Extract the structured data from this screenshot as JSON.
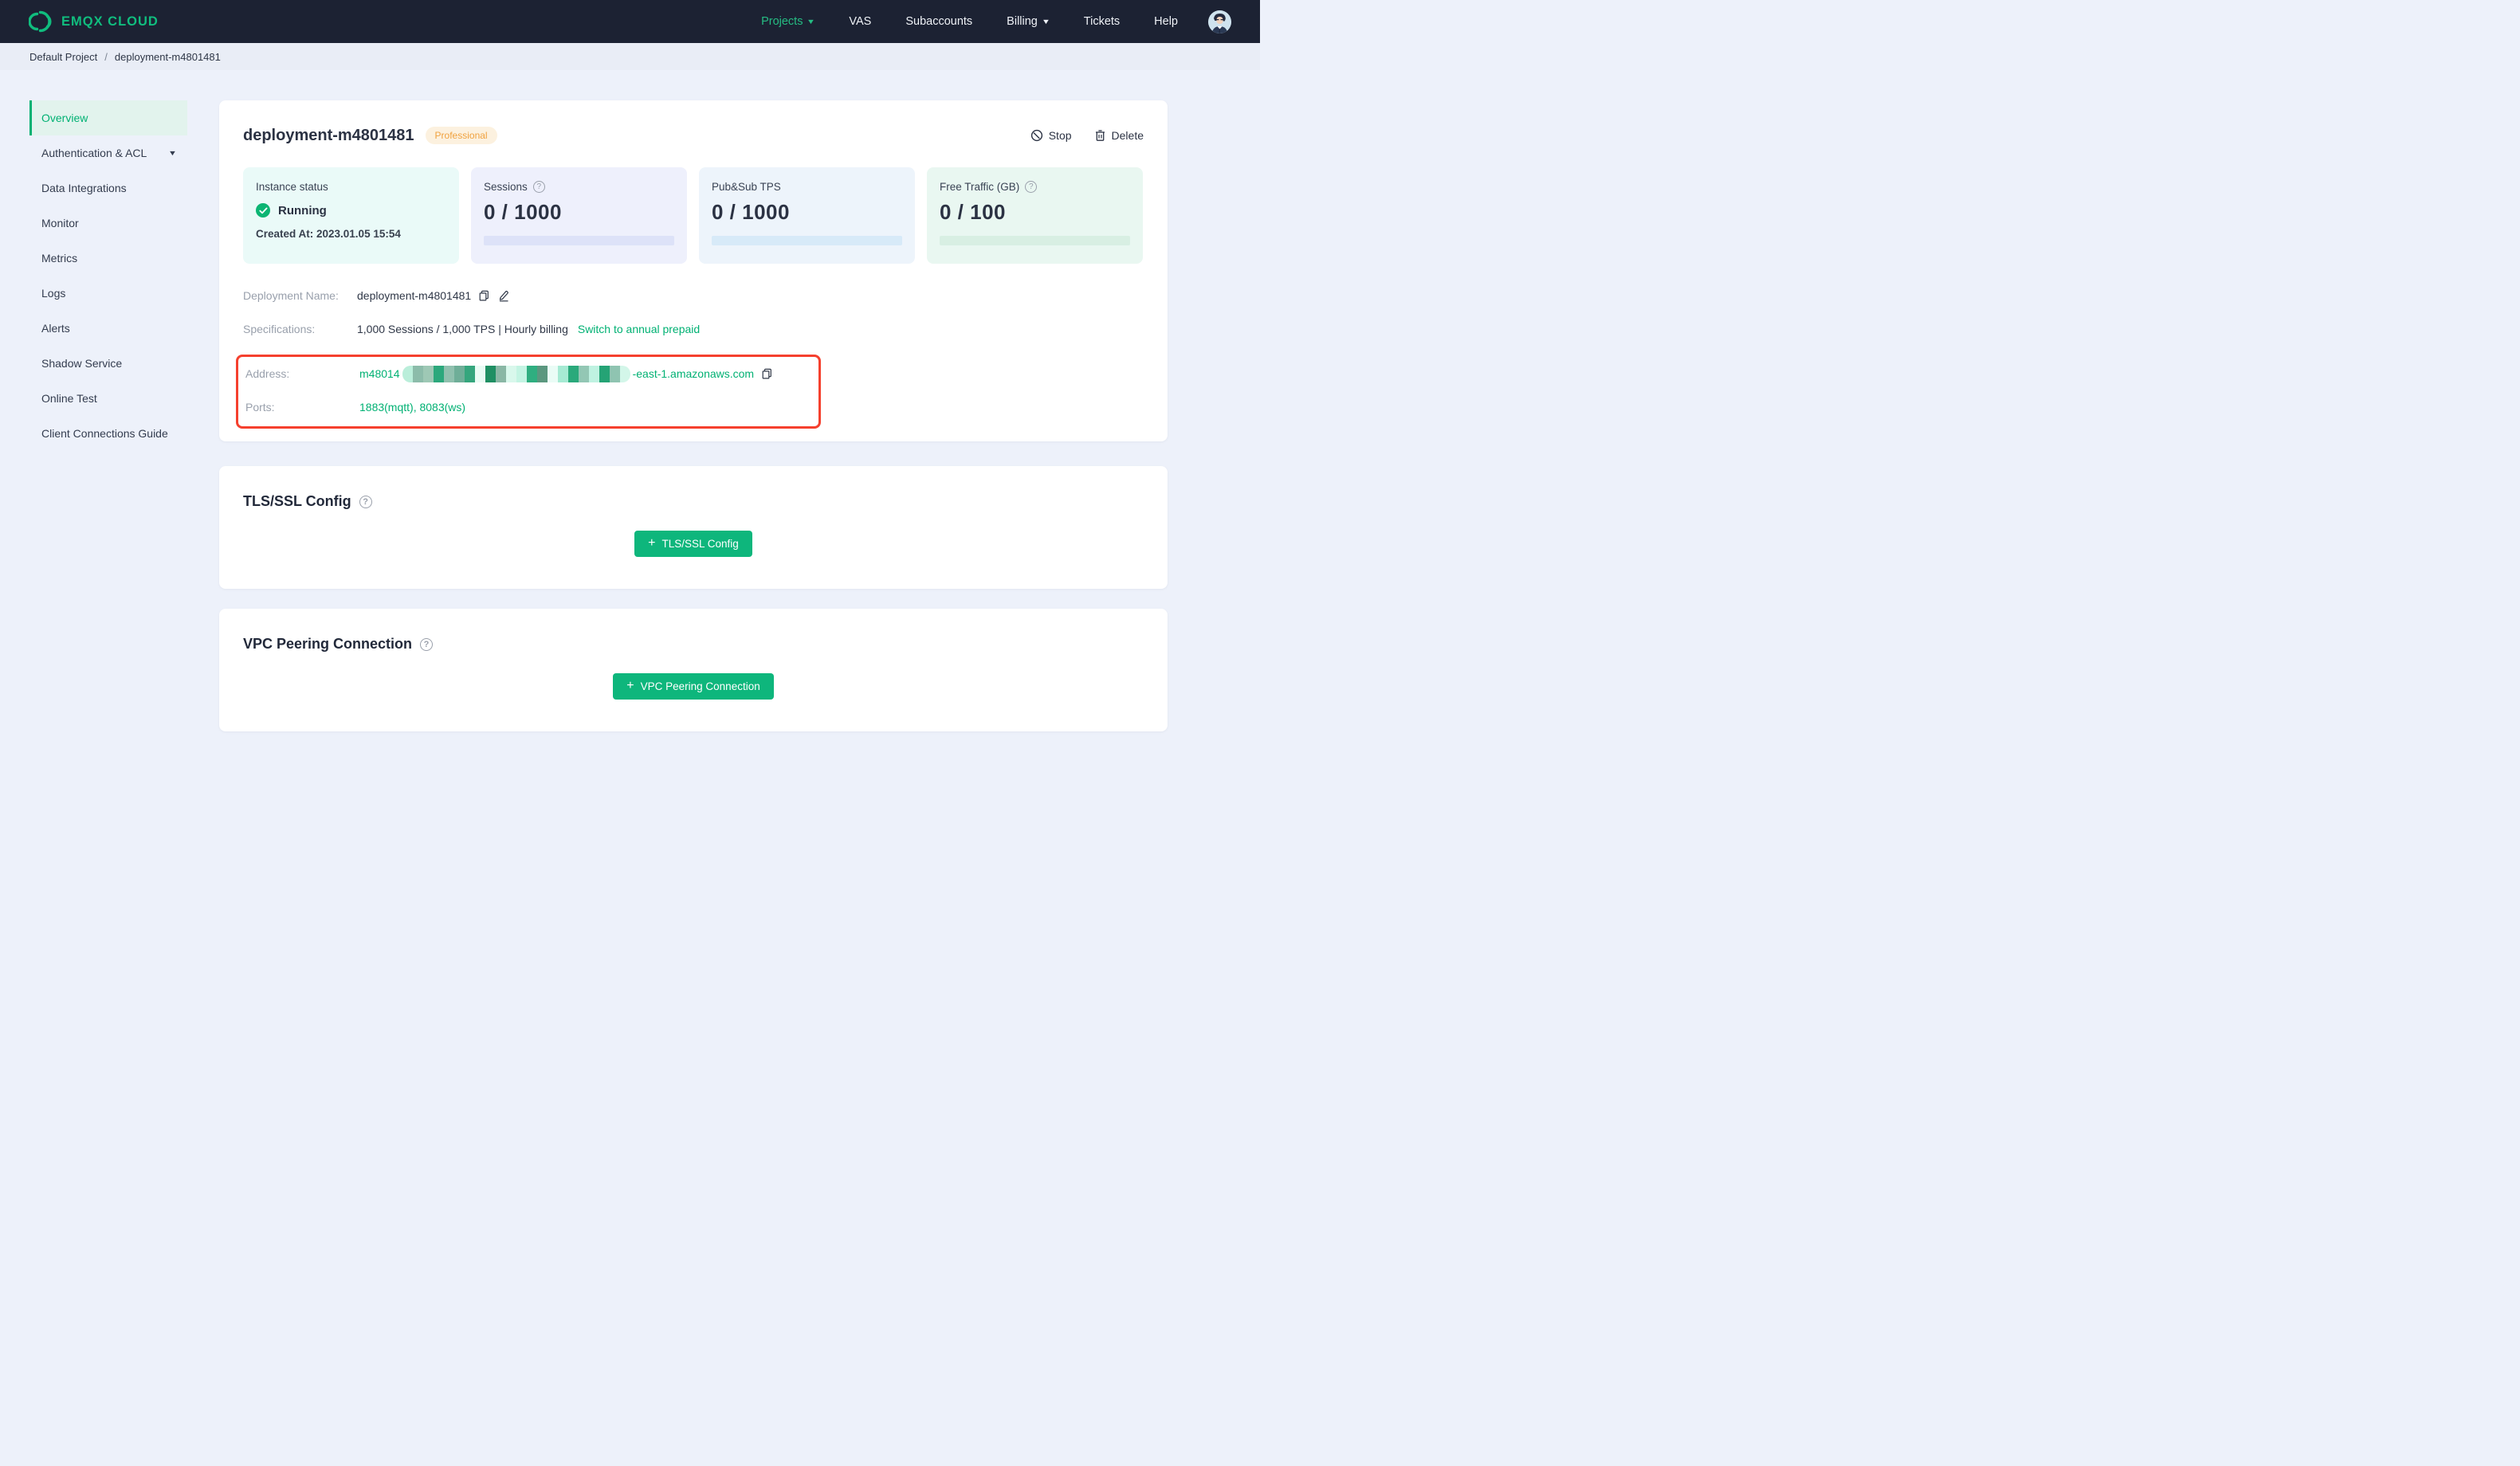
{
  "brand": {
    "name": "EMQX CLOUD"
  },
  "nav": {
    "items": [
      {
        "label": "Projects",
        "active": true,
        "caret": true
      },
      {
        "label": "VAS"
      },
      {
        "label": "Subaccounts"
      },
      {
        "label": "Billing",
        "caret": true
      },
      {
        "label": "Tickets"
      },
      {
        "label": "Help"
      }
    ]
  },
  "breadcrumb": {
    "project": "Default Project",
    "separator": "/",
    "current": "deployment-m4801481"
  },
  "sidebar": {
    "items": [
      {
        "label": "Overview",
        "active": true
      },
      {
        "label": "Authentication & ACL",
        "caret": true
      },
      {
        "label": "Data Integrations"
      },
      {
        "label": "Monitor"
      },
      {
        "label": "Metrics"
      },
      {
        "label": "Logs"
      },
      {
        "label": "Alerts"
      },
      {
        "label": "Shadow Service"
      },
      {
        "label": "Online Test"
      },
      {
        "label": "Client Connections Guide"
      }
    ]
  },
  "deployment": {
    "title": "deployment-m4801481",
    "plan_badge": "Professional",
    "actions": {
      "stop": "Stop",
      "delete": "Delete"
    },
    "status_card": {
      "label": "Instance status",
      "value": "Running",
      "created_at": "Created At: 2023.01.05 15:54",
      "bg": "#eafaf8"
    },
    "metric_cards": [
      {
        "label": "Sessions",
        "help": true,
        "value": "0 / 1000",
        "bg": "#eef0fc",
        "bar": "#dde2f8"
      },
      {
        "label": "Pub&Sub TPS",
        "help": false,
        "value": "0 / 1000",
        "bg": "#edf4fb",
        "bar": "#d7eaf8"
      },
      {
        "label": "Free Traffic (GB)",
        "help": true,
        "value": "0 / 100",
        "bg": "#e9f7f1",
        "bar": "#d8efe3"
      }
    ],
    "info": {
      "deployment_name": {
        "label": "Deployment Name:",
        "value": "deployment-m4801481"
      },
      "specifications": {
        "label": "Specifications:",
        "value": "1,000 Sessions / 1,000 TPS | Hourly billing",
        "link": "Switch to annual prepaid"
      },
      "address": {
        "label": "Address:",
        "prefix": "m48014",
        "suffix": "-east-1.amazonaws.com",
        "redacted_blocks": [
          "#baeeda",
          "#8cbcaa",
          "#9ec8b5",
          "#2ca87c",
          "#90c0ae",
          "#6fae98",
          "#35a67d",
          "#e9fbf4",
          "#1f8f63",
          "#8ab7a5",
          "#d9f8ec",
          "#c4f4e3",
          "#2fae80",
          "#5b977f",
          "#eafcf6",
          "#a6ead3",
          "#2aa97b",
          "#93c7b4",
          "#bff2e1",
          "#25a375",
          "#8fc4b1",
          "#d3f6e9"
        ]
      },
      "ports": {
        "label": "Ports:",
        "value": "1883(mqtt), 8083(ws)"
      }
    }
  },
  "sections": {
    "tls": {
      "title": "TLS/SSL Config",
      "button": "TLS/SSL Config"
    },
    "vpc": {
      "title": "VPC Peering Connection",
      "button": "VPC Peering Connection"
    }
  },
  "colors": {
    "accent_green": "#00b173",
    "button_green": "#0eb67c",
    "header_bg": "#1c2233",
    "annotation_red": "#f5402e",
    "badge_bg": "#fcf1df",
    "badge_text": "#f0a23f",
    "running_green": "#0cb573"
  }
}
